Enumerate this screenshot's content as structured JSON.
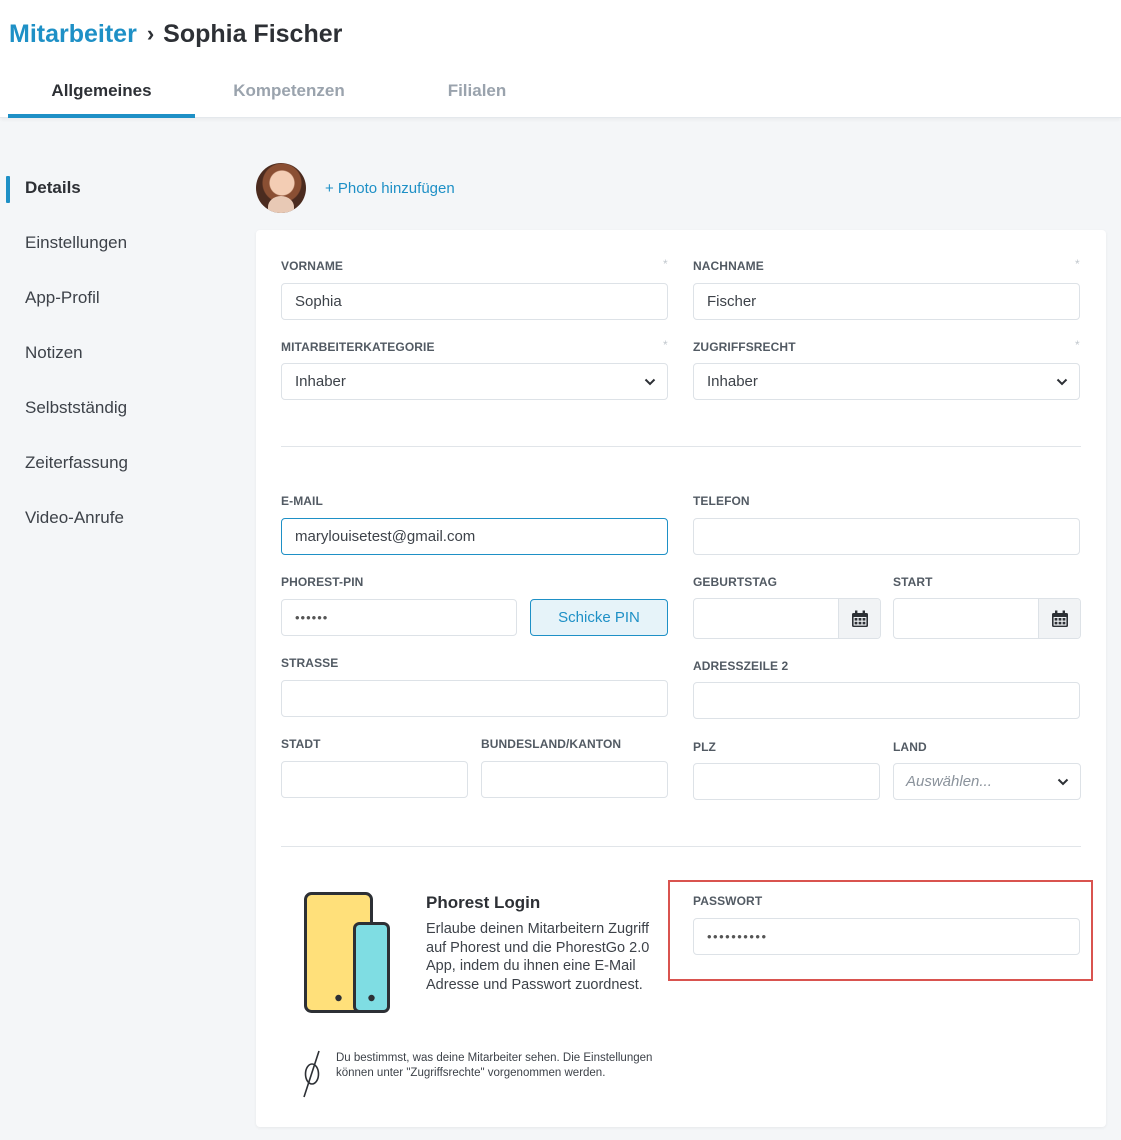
{
  "breadcrumb": {
    "parent": "Mitarbeiter",
    "separator": "›",
    "current": "Sophia Fischer"
  },
  "tabs": [
    {
      "label": "Allgemeines",
      "active": true
    },
    {
      "label": "Kompetenzen",
      "active": false
    },
    {
      "label": "Filialen",
      "active": false
    }
  ],
  "sidebar": {
    "items": [
      {
        "label": "Details",
        "active": true
      },
      {
        "label": "Einstellungen"
      },
      {
        "label": "App-Profil"
      },
      {
        "label": "Notizen"
      },
      {
        "label": "Selbstständig"
      },
      {
        "label": "Zeiterfassung"
      },
      {
        "label": "Video-Anrufe"
      }
    ]
  },
  "photo": {
    "add_label": "+ Photo hinzufügen",
    "avatar_icon": "user-photo"
  },
  "form": {
    "required_mark": "*",
    "vorname": {
      "label": "VORNAME",
      "value": "Sophia"
    },
    "nachname": {
      "label": "NACHNAME",
      "value": "Fischer"
    },
    "kategorie": {
      "label": "MITARBEITERKATEGORIE",
      "value": "Inhaber"
    },
    "zugriff": {
      "label": "ZUGRIFFSRECHT",
      "value": "Inhaber"
    },
    "email": {
      "label": "E-MAIL",
      "value": "marylouisetest@gmail.com"
    },
    "telefon": {
      "label": "TELEFON",
      "value": ""
    },
    "pin": {
      "label": "PHOREST-PIN",
      "value": "••••••",
      "button": "Schicke PIN"
    },
    "geburtstag": {
      "label": "GEBURTSTAG",
      "value": ""
    },
    "start": {
      "label": "START",
      "value": ""
    },
    "strasse": {
      "label": "STRASSE",
      "value": ""
    },
    "adresszeile2": {
      "label": "ADRESSZEILE 2",
      "value": ""
    },
    "stadt": {
      "label": "STADT",
      "value": ""
    },
    "bundesland": {
      "label": "BUNDESLAND/KANTON",
      "value": ""
    },
    "plz": {
      "label": "PLZ",
      "value": ""
    },
    "land": {
      "label": "LAND",
      "placeholder": "Auswählen..."
    },
    "passwort": {
      "label": "PASSWORT",
      "value": "••••••••••"
    }
  },
  "login_info": {
    "title": "Phorest Login",
    "description": "Erlaube deinen Mitarbeitern Zugriff auf Phorest und die PhorestGo 2.0 App, indem du ihnen eine E-Mail Adresse und Passwort zuordnest.",
    "note": "Du bestimmst, was deine Mitarbeiter sehen. Die Einstellungen können unter \"Zugriffsrechte\" vorgenommen werden."
  },
  "colors": {
    "accent": "#1e90c6",
    "highlight_border": "#d9534f",
    "device_yellow": "#ffe07a",
    "device_cyan": "#7fdde3"
  }
}
